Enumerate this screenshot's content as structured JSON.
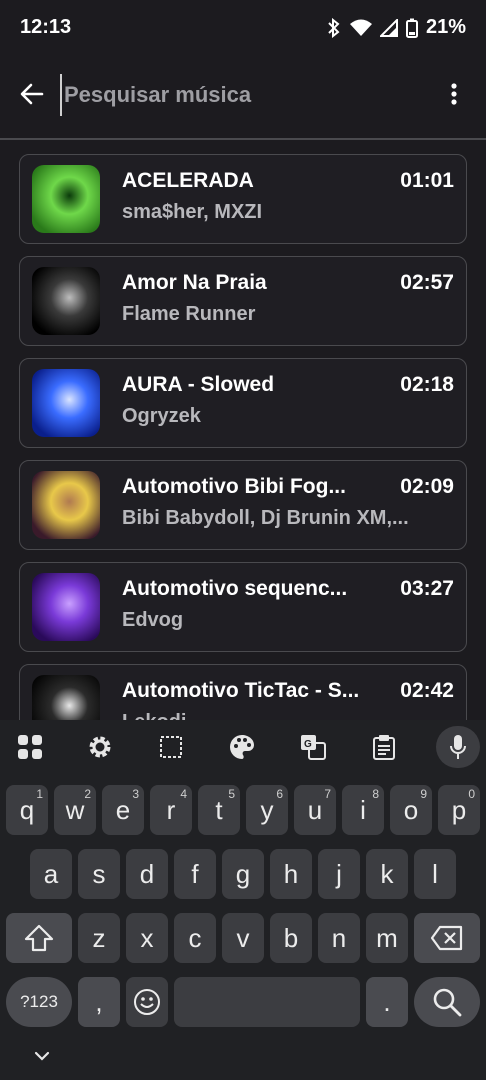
{
  "status_bar": {
    "time": "12:13",
    "battery": "21%",
    "icons": [
      "bluetooth-icon",
      "wifi-icon",
      "signal-icon",
      "battery-icon"
    ]
  },
  "search": {
    "placeholder": "Pesquisar música",
    "value": ""
  },
  "songs": [
    {
      "title": "ACELERADA",
      "artist": "sma$her, MXZI",
      "duration": "01:01",
      "colors": [
        "#2a7a1a",
        "#6fd84a",
        "#0b3b0b"
      ]
    },
    {
      "title": "Amor Na Praia",
      "artist": "Flame Runner",
      "duration": "02:57",
      "colors": [
        "#000000",
        "#3a3a3a",
        "#bdbdbd"
      ]
    },
    {
      "title": "AURA - Slowed",
      "artist": "Ogryzek",
      "duration": "02:18",
      "colors": [
        "#0a1f8c",
        "#3a6cff",
        "#d9e4ff"
      ]
    },
    {
      "title": "Automotivo Bibi Fog...",
      "artist": "Bibi Babydoll, Dj Brunin XM,...",
      "duration": "02:09",
      "colors": [
        "#3a1a2a",
        "#e8c84a",
        "#b07a50"
      ]
    },
    {
      "title": "Automotivo sequenc...",
      "artist": "Edvog",
      "duration": "03:27",
      "colors": [
        "#2a0a5a",
        "#7a3ad8",
        "#c9a0ff"
      ]
    },
    {
      "title": "Automotivo TicTac - S...",
      "artist": "Lekodj",
      "duration": "02:42",
      "colors": [
        "#050505",
        "#2b2b2b",
        "#e8e8e8"
      ]
    }
  ],
  "keyboard": {
    "row1": [
      {
        "k": "q",
        "h": "1"
      },
      {
        "k": "w",
        "h": "2"
      },
      {
        "k": "e",
        "h": "3"
      },
      {
        "k": "r",
        "h": "4"
      },
      {
        "k": "t",
        "h": "5"
      },
      {
        "k": "y",
        "h": "6"
      },
      {
        "k": "u",
        "h": "7"
      },
      {
        "k": "i",
        "h": "8"
      },
      {
        "k": "o",
        "h": "9"
      },
      {
        "k": "p",
        "h": "0"
      }
    ],
    "row2": [
      "a",
      "s",
      "d",
      "f",
      "g",
      "h",
      "j",
      "k",
      "l"
    ],
    "row3": [
      "z",
      "x",
      "c",
      "v",
      "b",
      "n",
      "m"
    ],
    "symbols_label": "?123",
    "comma": ",",
    "period": ".",
    "space": ""
  },
  "colors": {
    "background": "#1c1b1f",
    "card_border": "#4a4a4e",
    "keyboard_bg": "#202124",
    "key_bg": "#3c3d41"
  }
}
